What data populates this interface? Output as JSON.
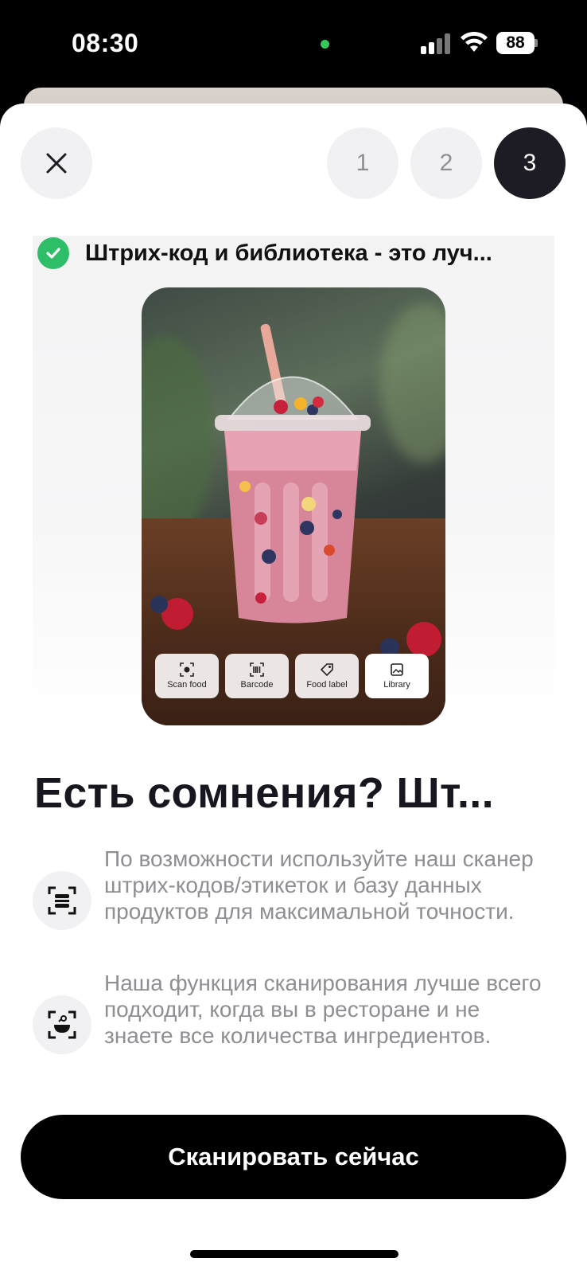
{
  "status_bar": {
    "time": "08:30",
    "battery": "88"
  },
  "steps": [
    "1",
    "2",
    "3"
  ],
  "active_step": 3,
  "hero": {
    "check_text": "Штрих-код и библиотека - это луч...",
    "scan_options": [
      {
        "label": "Scan food",
        "icon": "scan-food-icon"
      },
      {
        "label": "Barcode",
        "icon": "barcode-icon"
      },
      {
        "label": "Food label",
        "icon": "food-label-icon"
      },
      {
        "label": "Library",
        "icon": "library-icon"
      }
    ]
  },
  "headline": "Есть сомнения? Шт...",
  "tips": [
    {
      "icon": "barcode-scan-icon",
      "text": "По возможности используйте наш сканер штрих-кодов/этикеток и базу данных продуктов для максимальной точности."
    },
    {
      "icon": "food-scan-icon",
      "text": "Наша функция сканирования лучше всего подходит, когда вы в ресторане и не знаете все количества ингредиентов."
    }
  ],
  "cta_label": "Сканировать сейчас",
  "colors": {
    "accent_green": "#2fbe68",
    "active_step": "#1d1b24",
    "muted_text": "#8e8e93"
  }
}
